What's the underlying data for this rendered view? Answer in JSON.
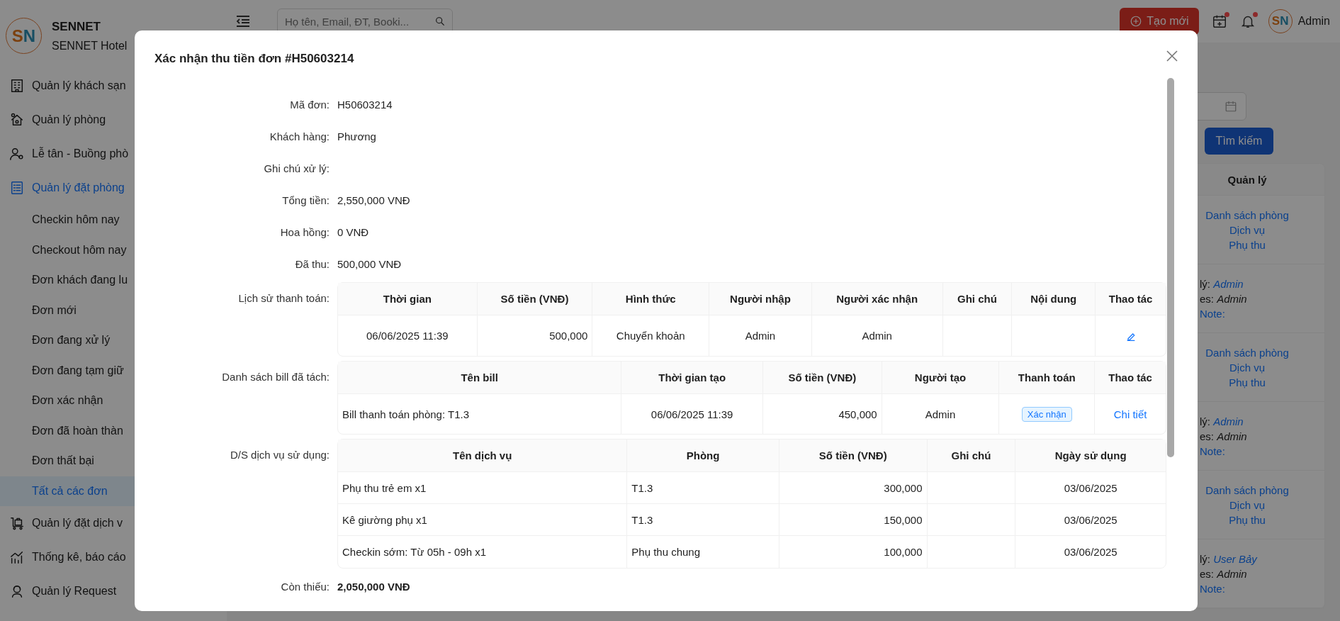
{
  "sidebar": {
    "logo": "SN",
    "brand": "SENNET",
    "subtitle": "SENNET Hotel",
    "items": [
      {
        "label": "Quản lý khách sạn",
        "active": false
      },
      {
        "label": "Quản lý phòng",
        "active": false
      },
      {
        "label": "Lễ tân - Buồng phò",
        "active": false
      },
      {
        "label": "Quản lý đặt phòng",
        "active": true,
        "children": [
          {
            "label": "Checkin hôm nay",
            "selected": false
          },
          {
            "label": "Checkout hôm nay",
            "selected": false
          },
          {
            "label": "Đơn khách đang lu",
            "selected": false
          },
          {
            "label": "Đơn mới",
            "selected": false
          },
          {
            "label": "Đơn đang xử lý",
            "selected": false
          },
          {
            "label": "Đơn đang tạm giữ",
            "selected": false
          },
          {
            "label": "Đơn xác nhận",
            "selected": false
          },
          {
            "label": "Đơn đã hoàn thàn",
            "selected": false
          },
          {
            "label": "Đơn thất bại",
            "selected": false
          },
          {
            "label": "Tất cả các đơn",
            "selected": true
          }
        ]
      },
      {
        "label": "Quản lý đặt dịch v",
        "active": false
      },
      {
        "label": "Thống kê, báo cáo",
        "active": false
      },
      {
        "label": "Quản lý Request",
        "active": false
      }
    ]
  },
  "topbar": {
    "search": {
      "placeholder": "Họ tên, Email, ĐT, Booki..."
    },
    "create_button": "Tạo mới",
    "notifications": [
      {
        "badge": true
      },
      {
        "badge": true
      }
    ],
    "user": {
      "avatar": "SN",
      "name": "Admin"
    }
  },
  "filters": {
    "search_button": "Tìm kiếm"
  },
  "bookings_table": {
    "columns": [
      "Quản lý"
    ],
    "rows": [
      {
        "kind": "links",
        "links": [
          "Danh sách phòng",
          "Dịch vụ",
          "Phụ thu"
        ]
      },
      {
        "kind": "meta",
        "lines": [
          {
            "kind": "handler",
            "label": "lý:",
            "value": "Admin"
          },
          {
            "kind": "creator",
            "label": "es:",
            "value": "Admin"
          },
          {
            "kind": "note",
            "label": "Note:"
          }
        ]
      },
      {
        "kind": "links",
        "links": [
          "Danh sách phòng",
          "Dịch vụ",
          "Phụ thu"
        ]
      },
      {
        "kind": "meta",
        "lines": [
          {
            "kind": "handler",
            "label": "lý:",
            "value": "Admin"
          },
          {
            "kind": "creator",
            "label": "es:",
            "value": "Admin"
          },
          {
            "kind": "note",
            "label": "Note:"
          }
        ]
      },
      {
        "kind": "links",
        "links": [
          "Danh sách phòng",
          "Dịch vụ",
          "Phụ thu"
        ]
      },
      {
        "kind": "meta",
        "lines": [
          {
            "kind": "handler",
            "label": "lý:",
            "value": "User Bảy"
          },
          {
            "kind": "creator",
            "label": "es:",
            "value": "Admin"
          },
          {
            "kind": "note",
            "label": "Note:"
          }
        ]
      }
    ]
  },
  "modal": {
    "title": "Xác nhận thu tiền đơn #H50603214",
    "fields": [
      {
        "kind": "text",
        "label": "Mã đơn:",
        "value": "H50603214"
      },
      {
        "kind": "text",
        "label": "Khách hàng:",
        "value": "Phương"
      },
      {
        "kind": "text",
        "label": "Ghi chú xử lý:"
      },
      {
        "kind": "text",
        "label": "Tổng tiền:",
        "value": "2,550,000 VNĐ"
      },
      {
        "kind": "text",
        "label": "Hoa hồng:",
        "value": "0 VNĐ"
      },
      {
        "kind": "text",
        "label": "Đã thu:",
        "value": "500,000 VNĐ"
      },
      {
        "kind": "table",
        "label": "Lịch sử thanh toán:",
        "columns": [
          {
            "title": "Thời gian",
            "kind": "center"
          },
          {
            "title": "Số tiền (VNĐ)",
            "kind": "amount"
          },
          {
            "title": "Hình thức",
            "kind": "center"
          },
          {
            "title": "Người nhập",
            "kind": "center"
          },
          {
            "title": "Người xác nhận",
            "kind": "center"
          },
          {
            "title": "Ghi chú",
            "kind": "center"
          },
          {
            "title": "Nội dung",
            "kind": "center"
          },
          {
            "title": "Thao tác",
            "kind": "center"
          }
        ],
        "rows": [
          [
            "06/06/2025 11:39",
            "500,000",
            "Chuyển khoản",
            "Admin",
            "Admin",
            null,
            null,
            {
              "kind": "edit"
            }
          ]
        ]
      },
      {
        "kind": "table",
        "label": "Danh sách bill đã tách:",
        "columns": [
          {
            "title": "Tên bill",
            "kind": "name"
          },
          {
            "title": "Thời gian tạo",
            "kind": "center"
          },
          {
            "title": "Số tiền (VNĐ)",
            "kind": "amount"
          },
          {
            "title": "Người tạo",
            "kind": "center"
          },
          {
            "title": "Thanh toán",
            "kind": "center"
          },
          {
            "title": "Thao tác",
            "kind": "center"
          }
        ],
        "rows": [
          [
            "Bill thanh toán phòng: T1.3",
            "06/06/2025 11:39",
            "450,000",
            "Admin",
            {
              "kind": "badge",
              "text": "Xác nhận"
            },
            {
              "kind": "link",
              "text": "Chi tiết"
            }
          ]
        ]
      },
      {
        "kind": "table",
        "label": "D/S dịch vụ sử dụng:",
        "columns": [
          {
            "title": "Tên dịch vụ",
            "kind": "name"
          },
          {
            "title": "Phòng",
            "kind": "name"
          },
          {
            "title": "Số tiền (VNĐ)",
            "kind": "amount"
          },
          {
            "title": "Ghi chú",
            "kind": "center"
          },
          {
            "title": "Ngày sử dụng",
            "kind": "center"
          }
        ],
        "rows": [
          [
            "Phụ thu trẻ em x1",
            "T1.3",
            "300,000",
            null,
            "03/06/2025"
          ],
          [
            "Kê giường phụ x1",
            "T1.3",
            "150,000",
            null,
            "03/06/2025"
          ],
          [
            "Checkin sớm: Từ 05h - 09h x1",
            "Phụ thu chung",
            "100,000",
            null,
            "03/06/2025"
          ]
        ]
      },
      {
        "kind": "total",
        "label": "Còn thiếu:",
        "value": "2,050,000 VNĐ"
      }
    ]
  }
}
